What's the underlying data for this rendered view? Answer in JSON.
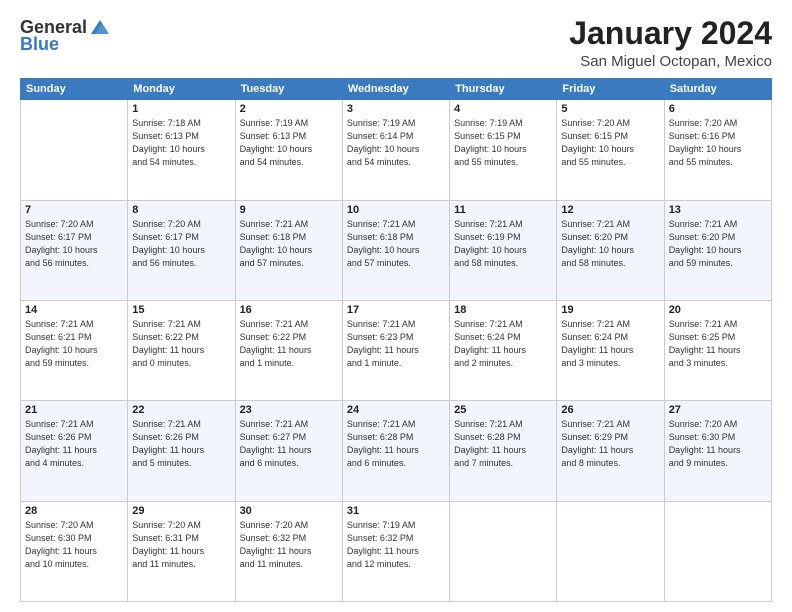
{
  "logo": {
    "general": "General",
    "blue": "Blue"
  },
  "title": "January 2024",
  "location": "San Miguel Octopan, Mexico",
  "days_of_week": [
    "Sunday",
    "Monday",
    "Tuesday",
    "Wednesday",
    "Thursday",
    "Friday",
    "Saturday"
  ],
  "weeks": [
    [
      {
        "day": "",
        "info": ""
      },
      {
        "day": "1",
        "info": "Sunrise: 7:18 AM\nSunset: 6:13 PM\nDaylight: 10 hours\nand 54 minutes."
      },
      {
        "day": "2",
        "info": "Sunrise: 7:19 AM\nSunset: 6:13 PM\nDaylight: 10 hours\nand 54 minutes."
      },
      {
        "day": "3",
        "info": "Sunrise: 7:19 AM\nSunset: 6:14 PM\nDaylight: 10 hours\nand 54 minutes."
      },
      {
        "day": "4",
        "info": "Sunrise: 7:19 AM\nSunset: 6:15 PM\nDaylight: 10 hours\nand 55 minutes."
      },
      {
        "day": "5",
        "info": "Sunrise: 7:20 AM\nSunset: 6:15 PM\nDaylight: 10 hours\nand 55 minutes."
      },
      {
        "day": "6",
        "info": "Sunrise: 7:20 AM\nSunset: 6:16 PM\nDaylight: 10 hours\nand 55 minutes."
      }
    ],
    [
      {
        "day": "7",
        "info": "Sunrise: 7:20 AM\nSunset: 6:17 PM\nDaylight: 10 hours\nand 56 minutes."
      },
      {
        "day": "8",
        "info": "Sunrise: 7:20 AM\nSunset: 6:17 PM\nDaylight: 10 hours\nand 56 minutes."
      },
      {
        "day": "9",
        "info": "Sunrise: 7:21 AM\nSunset: 6:18 PM\nDaylight: 10 hours\nand 57 minutes."
      },
      {
        "day": "10",
        "info": "Sunrise: 7:21 AM\nSunset: 6:18 PM\nDaylight: 10 hours\nand 57 minutes."
      },
      {
        "day": "11",
        "info": "Sunrise: 7:21 AM\nSunset: 6:19 PM\nDaylight: 10 hours\nand 58 minutes."
      },
      {
        "day": "12",
        "info": "Sunrise: 7:21 AM\nSunset: 6:20 PM\nDaylight: 10 hours\nand 58 minutes."
      },
      {
        "day": "13",
        "info": "Sunrise: 7:21 AM\nSunset: 6:20 PM\nDaylight: 10 hours\nand 59 minutes."
      }
    ],
    [
      {
        "day": "14",
        "info": "Sunrise: 7:21 AM\nSunset: 6:21 PM\nDaylight: 10 hours\nand 59 minutes."
      },
      {
        "day": "15",
        "info": "Sunrise: 7:21 AM\nSunset: 6:22 PM\nDaylight: 11 hours\nand 0 minutes."
      },
      {
        "day": "16",
        "info": "Sunrise: 7:21 AM\nSunset: 6:22 PM\nDaylight: 11 hours\nand 1 minute."
      },
      {
        "day": "17",
        "info": "Sunrise: 7:21 AM\nSunset: 6:23 PM\nDaylight: 11 hours\nand 1 minute."
      },
      {
        "day": "18",
        "info": "Sunrise: 7:21 AM\nSunset: 6:24 PM\nDaylight: 11 hours\nand 2 minutes."
      },
      {
        "day": "19",
        "info": "Sunrise: 7:21 AM\nSunset: 6:24 PM\nDaylight: 11 hours\nand 3 minutes."
      },
      {
        "day": "20",
        "info": "Sunrise: 7:21 AM\nSunset: 6:25 PM\nDaylight: 11 hours\nand 3 minutes."
      }
    ],
    [
      {
        "day": "21",
        "info": "Sunrise: 7:21 AM\nSunset: 6:26 PM\nDaylight: 11 hours\nand 4 minutes."
      },
      {
        "day": "22",
        "info": "Sunrise: 7:21 AM\nSunset: 6:26 PM\nDaylight: 11 hours\nand 5 minutes."
      },
      {
        "day": "23",
        "info": "Sunrise: 7:21 AM\nSunset: 6:27 PM\nDaylight: 11 hours\nand 6 minutes."
      },
      {
        "day": "24",
        "info": "Sunrise: 7:21 AM\nSunset: 6:28 PM\nDaylight: 11 hours\nand 6 minutes."
      },
      {
        "day": "25",
        "info": "Sunrise: 7:21 AM\nSunset: 6:28 PM\nDaylight: 11 hours\nand 7 minutes."
      },
      {
        "day": "26",
        "info": "Sunrise: 7:21 AM\nSunset: 6:29 PM\nDaylight: 11 hours\nand 8 minutes."
      },
      {
        "day": "27",
        "info": "Sunrise: 7:20 AM\nSunset: 6:30 PM\nDaylight: 11 hours\nand 9 minutes."
      }
    ],
    [
      {
        "day": "28",
        "info": "Sunrise: 7:20 AM\nSunset: 6:30 PM\nDaylight: 11 hours\nand 10 minutes."
      },
      {
        "day": "29",
        "info": "Sunrise: 7:20 AM\nSunset: 6:31 PM\nDaylight: 11 hours\nand 11 minutes."
      },
      {
        "day": "30",
        "info": "Sunrise: 7:20 AM\nSunset: 6:32 PM\nDaylight: 11 hours\nand 11 minutes."
      },
      {
        "day": "31",
        "info": "Sunrise: 7:19 AM\nSunset: 6:32 PM\nDaylight: 11 hours\nand 12 minutes."
      },
      {
        "day": "",
        "info": ""
      },
      {
        "day": "",
        "info": ""
      },
      {
        "day": "",
        "info": ""
      }
    ]
  ]
}
